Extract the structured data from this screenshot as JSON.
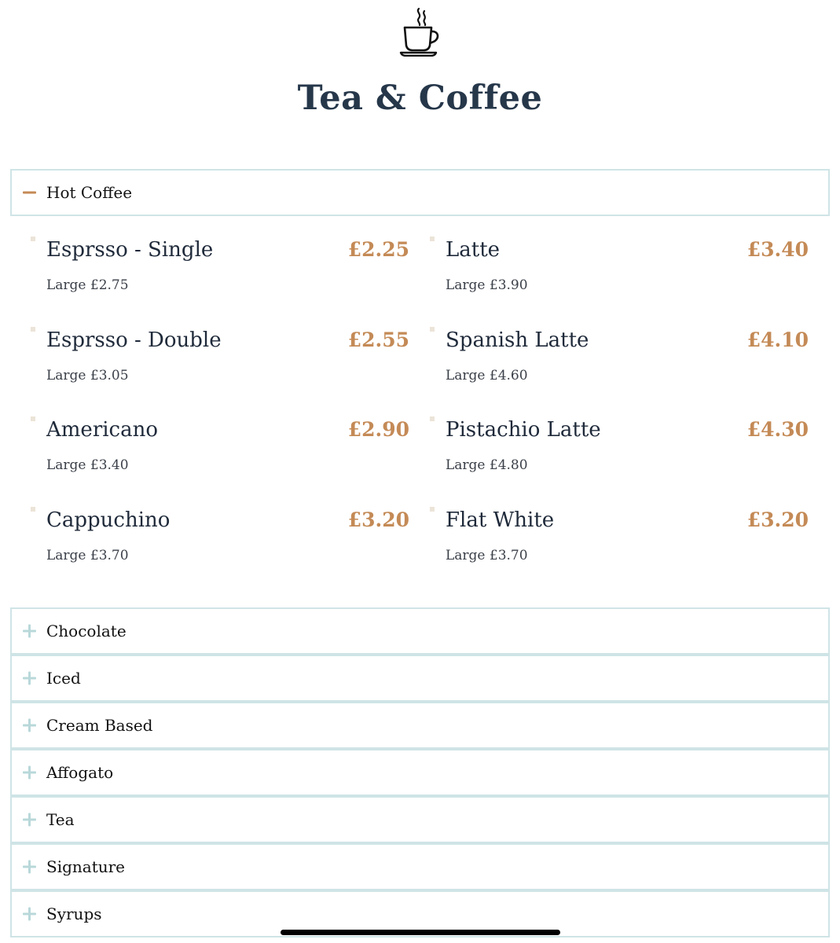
{
  "header": {
    "icon": "coffee-cup-icon",
    "title": "Tea & Coffee"
  },
  "colors": {
    "accent": "#c48a56",
    "border": "#cfe4e6",
    "plus": "#b9d8da",
    "title": "#26374a"
  },
  "sections": [
    {
      "label": "Hot Coffee",
      "expanded": true,
      "icon": "minus-icon"
    },
    {
      "label": "Chocolate",
      "expanded": false,
      "icon": "plus-icon"
    },
    {
      "label": "Iced",
      "expanded": false,
      "icon": "plus-icon"
    },
    {
      "label": "Cream Based",
      "expanded": false,
      "icon": "plus-icon"
    },
    {
      "label": "Affogato",
      "expanded": false,
      "icon": "plus-icon"
    },
    {
      "label": "Tea",
      "expanded": false,
      "icon": "plus-icon"
    },
    {
      "label": "Signature",
      "expanded": false,
      "icon": "plus-icon"
    },
    {
      "label": "Syrups",
      "expanded": false,
      "icon": "plus-icon"
    }
  ],
  "hot_coffee_items": [
    {
      "name": "Esprsso - Single",
      "price": "£2.25",
      "large": "Large £2.75"
    },
    {
      "name": "Latte",
      "price": "£3.40",
      "large": "Large £3.90"
    },
    {
      "name": "Esprsso - Double",
      "price": "£2.55",
      "large": "Large £3.05"
    },
    {
      "name": "Spanish Latte",
      "price": "£4.10",
      "large": "Large £4.60"
    },
    {
      "name": "Americano",
      "price": "£2.90",
      "large": "Large £3.40"
    },
    {
      "name": "Pistachio Latte",
      "price": "£4.30",
      "large": "Large £4.80"
    },
    {
      "name": "Cappuchino",
      "price": "£3.20",
      "large": "Large £3.70"
    },
    {
      "name": "Flat White",
      "price": "£3.20",
      "large": "Large £3.70"
    }
  ]
}
